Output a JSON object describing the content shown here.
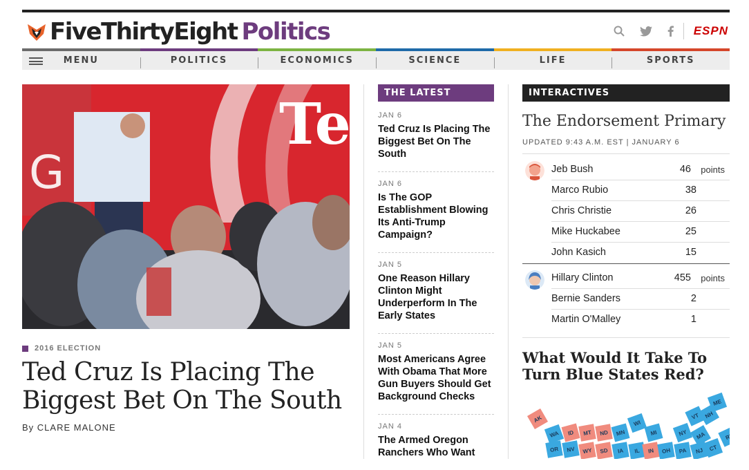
{
  "header": {
    "brand": "FiveThirtyEight",
    "section": "Politics",
    "espn_label": "ESPN",
    "icons": [
      "search-icon",
      "twitter-icon",
      "facebook-icon"
    ]
  },
  "nav": {
    "items": [
      {
        "label": "MENU",
        "color": "#6b6b6b"
      },
      {
        "label": "POLITICS",
        "color": "#6d3c7e"
      },
      {
        "label": "ECONOMICS",
        "color": "#7cb342"
      },
      {
        "label": "SCIENCE",
        "color": "#1e6aa8"
      },
      {
        "label": "LIFE",
        "color": "#f0b020"
      },
      {
        "label": "SPORTS",
        "color": "#d5462a"
      }
    ]
  },
  "feature": {
    "category": "2016 ELECTION",
    "headline": "Ted Cruz Is Placing The Biggest Bet On The South",
    "byline": "By CLARE MALONE",
    "image_sign_text": "Ted"
  },
  "latest": {
    "header": "THE LATEST",
    "items": [
      {
        "date": "JAN 6",
        "title": "Ted Cruz Is Placing The Biggest Bet On The South"
      },
      {
        "date": "JAN 6",
        "title": "Is The GOP Establishment Blowing Its Anti-Trump Campaign?"
      },
      {
        "date": "JAN 5",
        "title": "One Reason Hillary Clinton Might Underperform In The Early States"
      },
      {
        "date": "JAN 5",
        "title": "Most Americans Agree With Obama That More Gun Buyers Should Get Background Checks"
      },
      {
        "date": "JAN 4",
        "title": "The Armed Oregon Ranchers Who Want"
      }
    ]
  },
  "interactives": {
    "header": "INTERACTIVES",
    "endorsement": {
      "title": "The Endorsement Primary",
      "updated": "UPDATED 9:43 A.M. EST | JANUARY 6",
      "points_label": "points",
      "republicans": [
        {
          "name": "Jeb Bush",
          "points": "46"
        },
        {
          "name": "Marco Rubio",
          "points": "38"
        },
        {
          "name": "Chris Christie",
          "points": "26"
        },
        {
          "name": "Mike Huckabee",
          "points": "25"
        },
        {
          "name": "John Kasich",
          "points": "15"
        }
      ],
      "democrats": [
        {
          "name": "Hillary Clinton",
          "points": "455"
        },
        {
          "name": "Bernie Sanders",
          "points": "2"
        },
        {
          "name": "Martin O'Malley",
          "points": "1"
        }
      ]
    },
    "blue_states": {
      "title": "What Would It Take To Turn Blue States Red?",
      "tile_colors": {
        "red": "#f08b7e",
        "blue": "#3aa8e0"
      },
      "tiles": [
        {
          "abbr": "AK",
          "color": "red"
        },
        {
          "abbr": "WA",
          "color": "blue"
        },
        {
          "abbr": "ID",
          "color": "red"
        },
        {
          "abbr": "MT",
          "color": "red"
        },
        {
          "abbr": "ND",
          "color": "red"
        },
        {
          "abbr": "MN",
          "color": "blue"
        },
        {
          "abbr": "WI",
          "color": "blue"
        },
        {
          "abbr": "MI",
          "color": "blue"
        },
        {
          "abbr": "NY",
          "color": "blue"
        },
        {
          "abbr": "VT",
          "color": "blue"
        },
        {
          "abbr": "NH",
          "color": "blue"
        },
        {
          "abbr": "ME",
          "color": "blue"
        },
        {
          "abbr": "MA",
          "color": "blue"
        },
        {
          "abbr": "OR",
          "color": "blue"
        },
        {
          "abbr": "NV",
          "color": "blue"
        },
        {
          "abbr": "WY",
          "color": "red"
        },
        {
          "abbr": "SD",
          "color": "red"
        },
        {
          "abbr": "IA",
          "color": "blue"
        },
        {
          "abbr": "IL",
          "color": "blue"
        },
        {
          "abbr": "IN",
          "color": "red"
        },
        {
          "abbr": "OH",
          "color": "blue"
        },
        {
          "abbr": "PA",
          "color": "blue"
        },
        {
          "abbr": "NJ",
          "color": "blue"
        },
        {
          "abbr": "CT",
          "color": "blue"
        },
        {
          "abbr": "RI",
          "color": "blue"
        }
      ]
    }
  }
}
